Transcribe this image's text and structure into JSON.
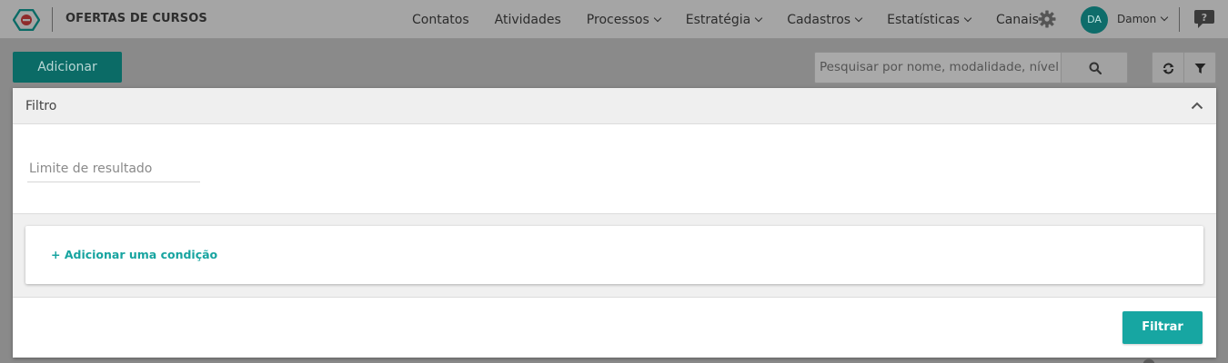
{
  "header": {
    "title": "OFERTAS DE CURSOS",
    "nav": [
      {
        "label": "Contatos",
        "dropdown": false
      },
      {
        "label": "Atividades",
        "dropdown": false
      },
      {
        "label": "Processos",
        "dropdown": true
      },
      {
        "label": "Estratégia",
        "dropdown": true
      },
      {
        "label": "Cadastros",
        "dropdown": true
      },
      {
        "label": "Estatísticas",
        "dropdown": true
      },
      {
        "label": "Canais",
        "dropdown": true
      }
    ],
    "user": {
      "initials": "DA",
      "name": "Damon"
    },
    "icons": [
      "logo-icon",
      "gear-icon",
      "chevron-down-icon",
      "help-chat-icon"
    ]
  },
  "toolbar": {
    "add_label": "Adicionar",
    "search_placeholder": "Pesquisar por nome, modalidade, nível",
    "icons": [
      "search-icon",
      "refresh-icon",
      "filter-icon"
    ]
  },
  "filter_panel": {
    "title": "Filtro",
    "limit_placeholder": "Limite de resultado",
    "add_condition": "+ Adicionar uma condição",
    "submit_label": "Filtrar"
  },
  "colors": {
    "accent": "#17a6a2",
    "add_button_dimmed": "#0b6b66",
    "overlay_dim": "#a5a5a5"
  }
}
